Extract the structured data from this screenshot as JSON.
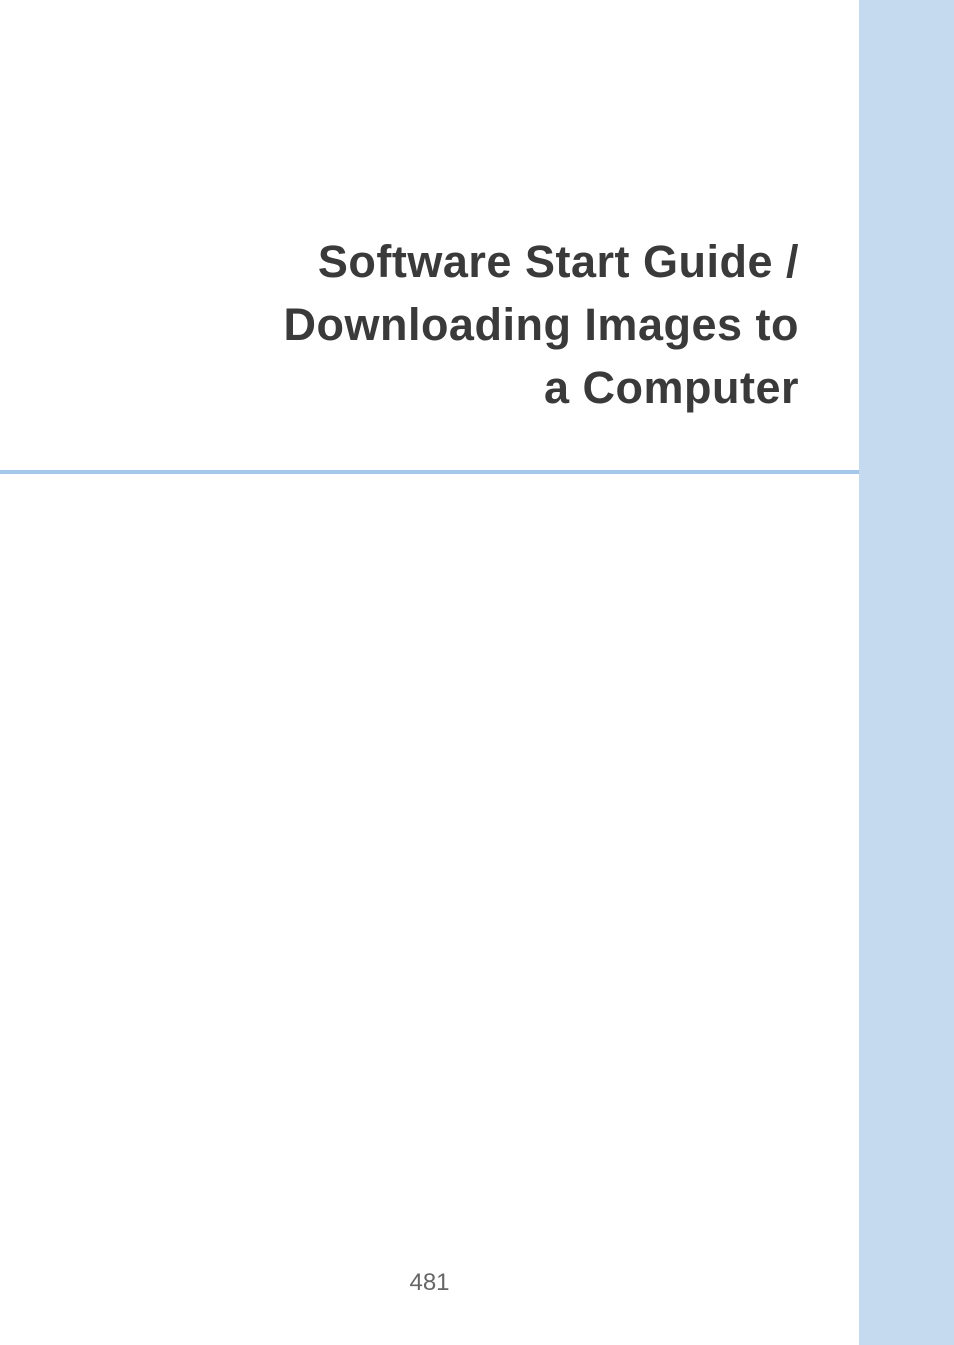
{
  "title": {
    "line1": "Software Start Guide /",
    "line2": "Downloading Images to",
    "line3": "a Computer"
  },
  "pageNumber": "481"
}
